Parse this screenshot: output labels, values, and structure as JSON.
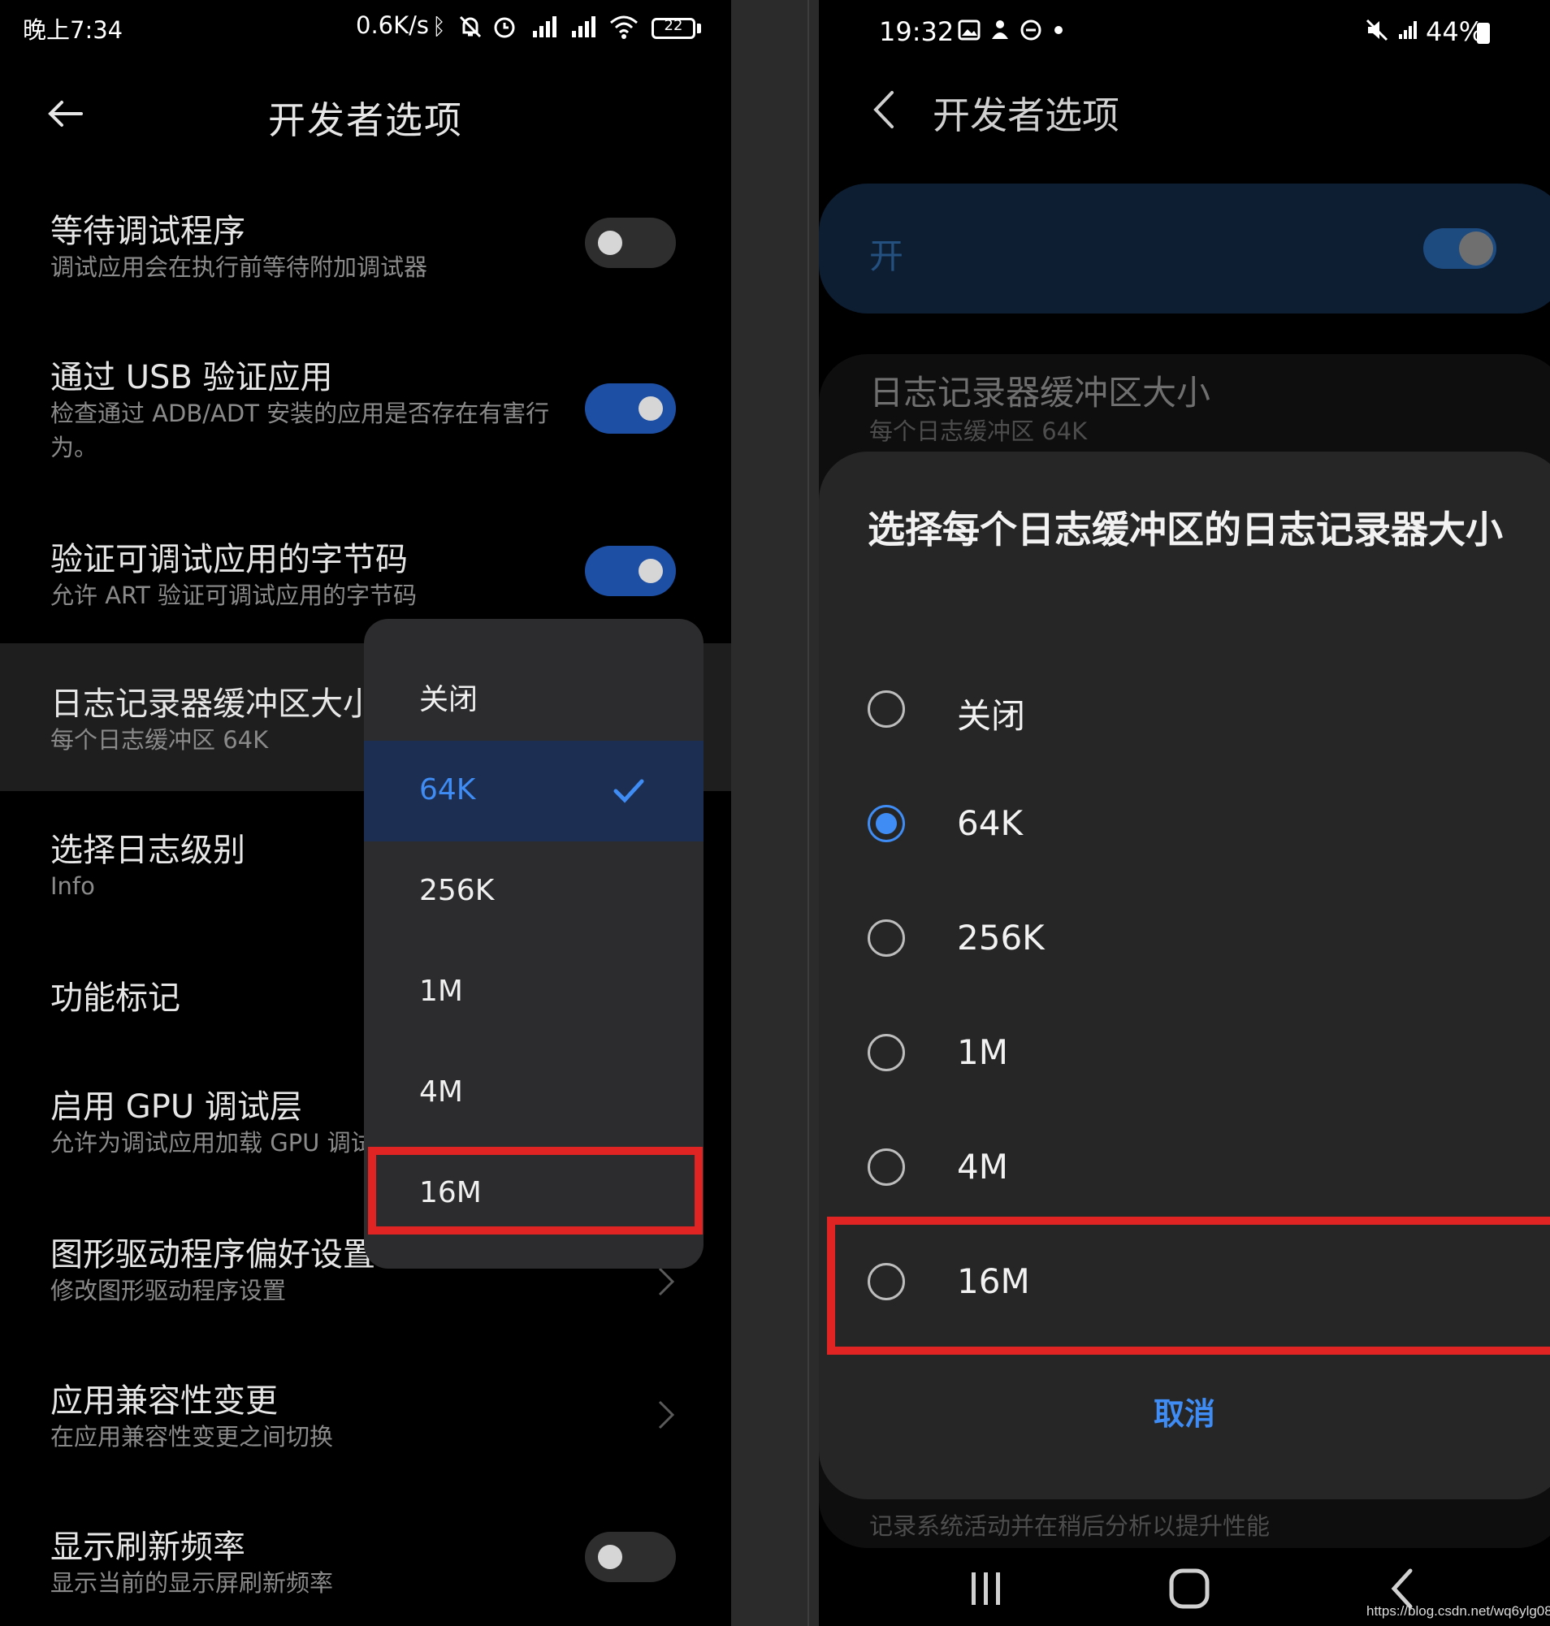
{
  "left": {
    "status": {
      "time": "晚上7:34",
      "speed": "0.6K/s",
      "battery": "22",
      "icons": [
        "bluetooth-icon",
        "mute-bell-icon",
        "alarm-icon",
        "hd-signal-icon",
        "hd-signal-icon",
        "wifi-icon",
        "battery-icon"
      ]
    },
    "title": "开发者选项",
    "items": [
      {
        "title": "等待调试程序",
        "subtitle": "调试应用会在执行前等待附加调试器",
        "toggle": "off"
      },
      {
        "title": "通过 USB 验证应用",
        "subtitle": "检查通过 ADB/ADT 安装的应用是否存在有害行为。",
        "toggle": "on"
      },
      {
        "title": "验证可调试应用的字节码",
        "subtitle": "允许 ART 验证可调试应用的字节码",
        "toggle": "on"
      },
      {
        "title": "日志记录器缓冲区大小",
        "subtitle": "每个日志缓冲区 64K"
      },
      {
        "title": "选择日志级别",
        "subtitle": "Info"
      },
      {
        "title": "功能标记",
        "subtitle": ""
      },
      {
        "title": "启用 GPU 调试层",
        "subtitle": "允许为调试应用加载 GPU 调试层"
      },
      {
        "title": "图形驱动程序偏好设置",
        "subtitle": "修改图形驱动程序设置"
      },
      {
        "title": "应用兼容性变更",
        "subtitle": "在应用兼容性变更之间切换"
      },
      {
        "title": "显示刷新频率",
        "subtitle": "显示当前的显示屏刷新频率",
        "toggle": "off"
      }
    ],
    "dropdown": {
      "options": [
        "关闭",
        "64K",
        "256K",
        "1M",
        "4M",
        "16M"
      ],
      "selected": "64K"
    }
  },
  "right": {
    "status": {
      "time": "19:32",
      "battery_pct": "44%",
      "icons": [
        "image-icon",
        "bixby-icon",
        "dnd-icon",
        "dot-icon",
        "mute-icon",
        "signal-icon",
        "battery-icon"
      ]
    },
    "title": "开发者选项",
    "master_label": "开",
    "bg_item_title": "日志记录器缓冲区大小",
    "bg_item_subtitle": "每个日志缓冲区 64K",
    "bg_item_below": "记录系统活动并在稍后分析以提升性能",
    "dialog": {
      "title": "选择每个日志缓冲区的日志记录器大小",
      "options": [
        "关闭",
        "64K",
        "256K",
        "1M",
        "4M",
        "16M"
      ],
      "selected": "64K",
      "cancel": "取消"
    },
    "navbar": [
      "recents-icon",
      "home-icon",
      "back-icon"
    ]
  },
  "watermark": "https://blog.csdn.net/wq6ylg08",
  "colors": {
    "accent": "#3f8cf5",
    "toggle_on": "#1d4fa5",
    "highlight": "#e02424"
  }
}
